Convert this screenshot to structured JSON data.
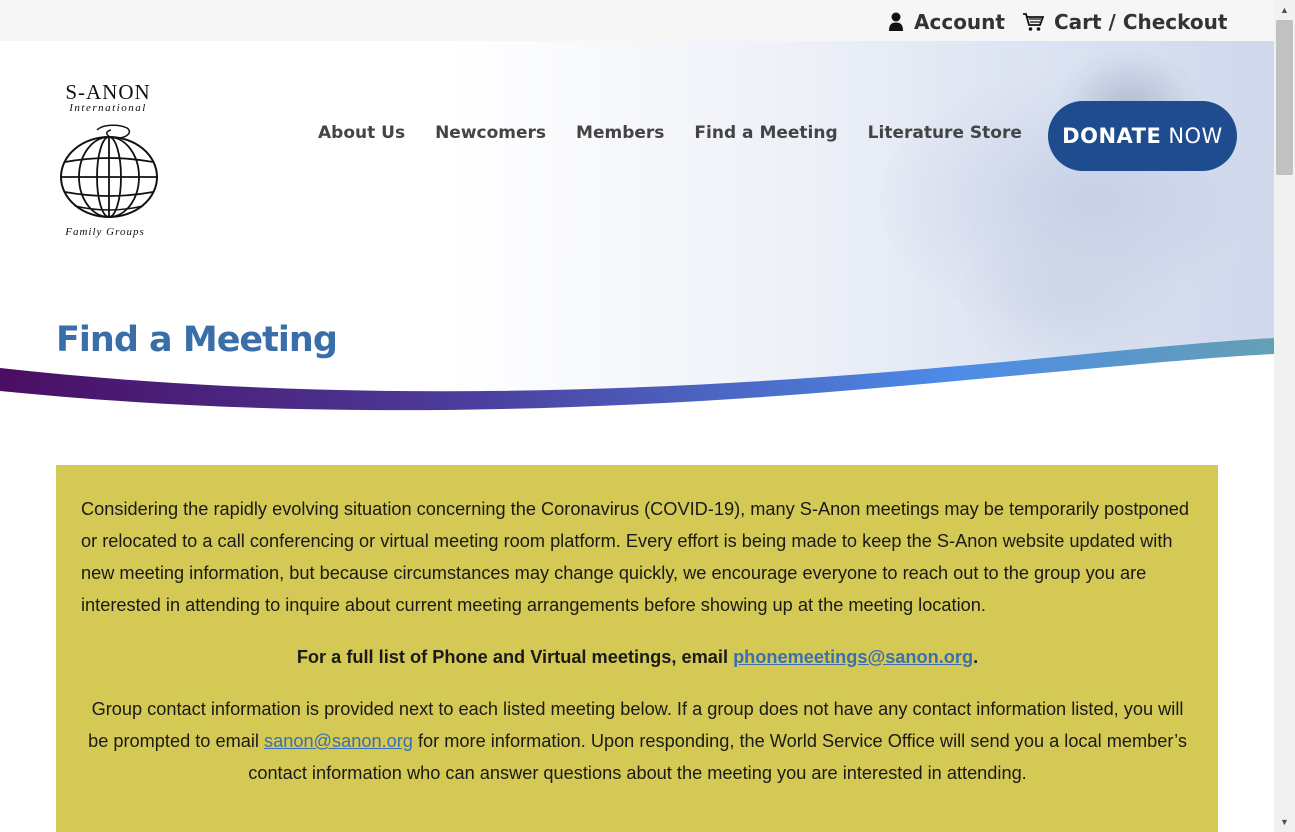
{
  "topbar": {
    "account_label": "Account",
    "cart_label": "Cart / Checkout",
    "account_icon": "user-icon",
    "cart_icon": "cart-icon"
  },
  "logo": {
    "line1": "S-ANON",
    "line2": "International",
    "line3": "Family Groups"
  },
  "nav": {
    "items": [
      {
        "label": "About Us"
      },
      {
        "label": "Newcomers"
      },
      {
        "label": "Members"
      },
      {
        "label": "Find a Meeting"
      },
      {
        "label": "Literature Store"
      }
    ]
  },
  "donate": {
    "bold": "DONATE",
    "rest": "NOW"
  },
  "page_title": "Find a Meeting",
  "notice": {
    "para1": "Considering the rapidly evolving situation concerning the Coronavirus (COVID-19), many S-Anon meetings may be temporarily postponed or relocated to a call conferencing or virtual meeting room platform. Every effort is being made to keep the S-Anon website updated with new meeting information, but because circumstances may change quickly, we encourage everyone to reach out to the group you are interested in attending to inquire about current meeting arrangements before showing up at the meeting location.",
    "para2_text": "For a full list of Phone and Virtual meetings, email ",
    "para2_link": "phonemeetings@sanon.org",
    "para2_end": ".",
    "para3_text": "Group contact information is provided next to each listed meeting below. If a group does not have any contact information listed, you will be prompted to email ",
    "para3_link": "sanon@sanon.org",
    "para3_end": " for more information. Upon responding, the World Service Office will send you a local member’s contact information who can answer questions about the meeting you are interested in attending."
  },
  "colors": {
    "brand_blue": "#1e4c8f",
    "title_blue": "#3a6ea8",
    "notice_bg": "#d4c954",
    "link": "#3b6fb0",
    "wave_start": "#4a0e63",
    "wave_end": "#64a0b4"
  }
}
